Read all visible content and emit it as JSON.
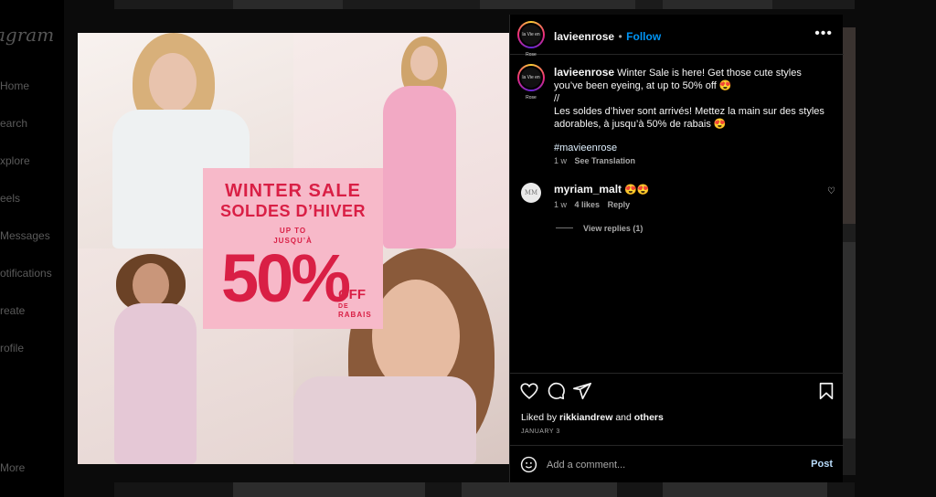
{
  "sidebar": {
    "brand": "agram",
    "items": [
      {
        "label": "Home",
        "icon": "home-icon"
      },
      {
        "label": "earch",
        "icon": "search-icon"
      },
      {
        "label": "xplore",
        "icon": "explore-icon"
      },
      {
        "label": "eels",
        "icon": "reels-icon"
      },
      {
        "label": "Messages",
        "icon": "messages-icon"
      },
      {
        "label": "otifications",
        "icon": "heart-icon"
      },
      {
        "label": "reate",
        "icon": "create-icon"
      },
      {
        "label": "rofile",
        "icon": "profile-icon"
      }
    ],
    "more": "More"
  },
  "post": {
    "image_text": {
      "line1": "WINTER SALE",
      "line2": "SOLDES D’HIVER",
      "line3": "UP TO",
      "line4": "JUSQU’À",
      "percent": "50%",
      "off": "OFF",
      "de": "DE",
      "rabais": "RABAIS"
    },
    "header": {
      "username": "lavieenrose",
      "separator": "•",
      "follow": "Follow",
      "avatar_text": "la Vie en Rose",
      "more_icon": "more-horizontal-icon"
    },
    "caption": {
      "username": "lavieenrose",
      "line1": " Winter Sale is here! Get those cute styles you’ve been eyeing, at up to 50% off 😍",
      "line2": "//",
      "line3": "Les soldes d’hiver sont arrivés! Mettez la main sur des styles adorables, à jusqu’à 50% de rabais 😍",
      "hashtag": "#mavieenrose",
      "time": "1 w",
      "see_translation": "See Translation"
    },
    "comment": {
      "avatar_text": "MM",
      "username": "myriam_malt",
      "text": " 😍😍",
      "time": "1 w",
      "likes": "4 likes",
      "reply": "Reply",
      "view_replies": "View replies (1)"
    },
    "likes": {
      "prefix": "Liked by ",
      "user": "rikkiandrew",
      "middle": " and ",
      "others": "others"
    },
    "date": "JANUARY 3",
    "comment_input": {
      "placeholder": "Add a comment...",
      "post": "Post"
    }
  },
  "colors": {
    "accent": "#0095f6",
    "sale_pink": "#f7b9c9",
    "sale_red": "#d91f45"
  }
}
